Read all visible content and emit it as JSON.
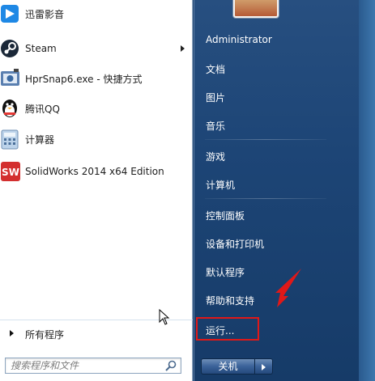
{
  "programs": [
    {
      "label": "迅雷影音",
      "icon": "xunlei-player-icon"
    },
    {
      "label": "Steam",
      "icon": "steam-icon",
      "has_submenu": true
    },
    {
      "label": "HprSnap6.exe - 快捷方式",
      "icon": "hypersnap-icon"
    },
    {
      "label": "腾讯QQ",
      "icon": "qq-penguin-icon"
    },
    {
      "label": "计算器",
      "icon": "calculator-icon"
    },
    {
      "label": "SolidWorks 2014 x64 Edition",
      "icon": "solidworks-icon"
    }
  ],
  "all_programs": "所有程序",
  "search": {
    "placeholder": "搜索程序和文件"
  },
  "right_menu": {
    "user": "Administrator",
    "items": [
      "文档",
      "图片",
      "音乐",
      "游戏",
      "计算机",
      "控制面板",
      "设备和打印机",
      "默认程序",
      "帮助和支持",
      "运行..."
    ]
  },
  "shutdown": {
    "label": "关机"
  },
  "colors": {
    "highlight": "#e01818",
    "right_pane": "#1d4576"
  }
}
